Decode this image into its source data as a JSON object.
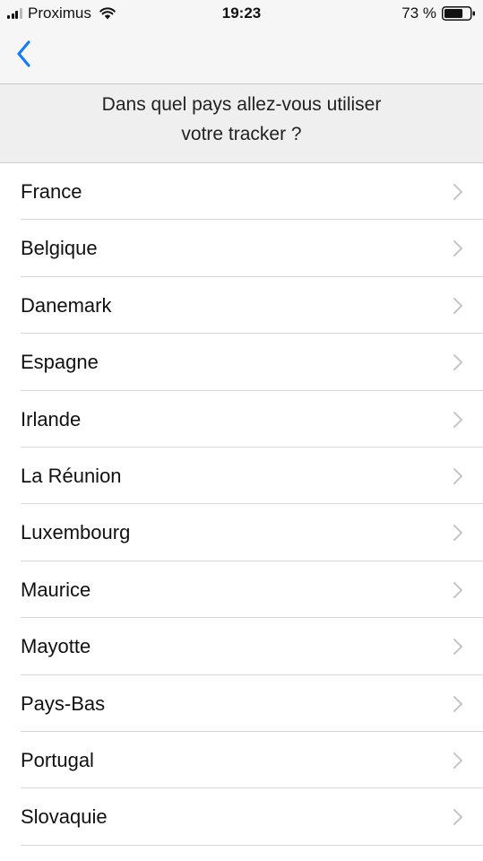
{
  "status_bar": {
    "carrier": "Proximus",
    "time": "19:23",
    "battery": "73 %",
    "battery_level": 0.73,
    "signal_bars": 3,
    "icons": [
      "signal-icon",
      "wifi-icon",
      "battery-icon"
    ]
  },
  "nav": {
    "back_icon": "chevron-left-icon",
    "accent_color": "#1a7cf2"
  },
  "header": {
    "question": "Dans quel pays allez-vous utiliser\nvotre tracker ?"
  },
  "countries": [
    {
      "label": "France"
    },
    {
      "label": "Belgique"
    },
    {
      "label": "Danemark"
    },
    {
      "label": "Espagne"
    },
    {
      "label": "Irlande"
    },
    {
      "label": "La Réunion"
    },
    {
      "label": "Luxembourg"
    },
    {
      "label": "Maurice"
    },
    {
      "label": "Mayotte"
    },
    {
      "label": "Pays-Bas"
    },
    {
      "label": "Portugal"
    },
    {
      "label": "Slovaquie"
    }
  ]
}
